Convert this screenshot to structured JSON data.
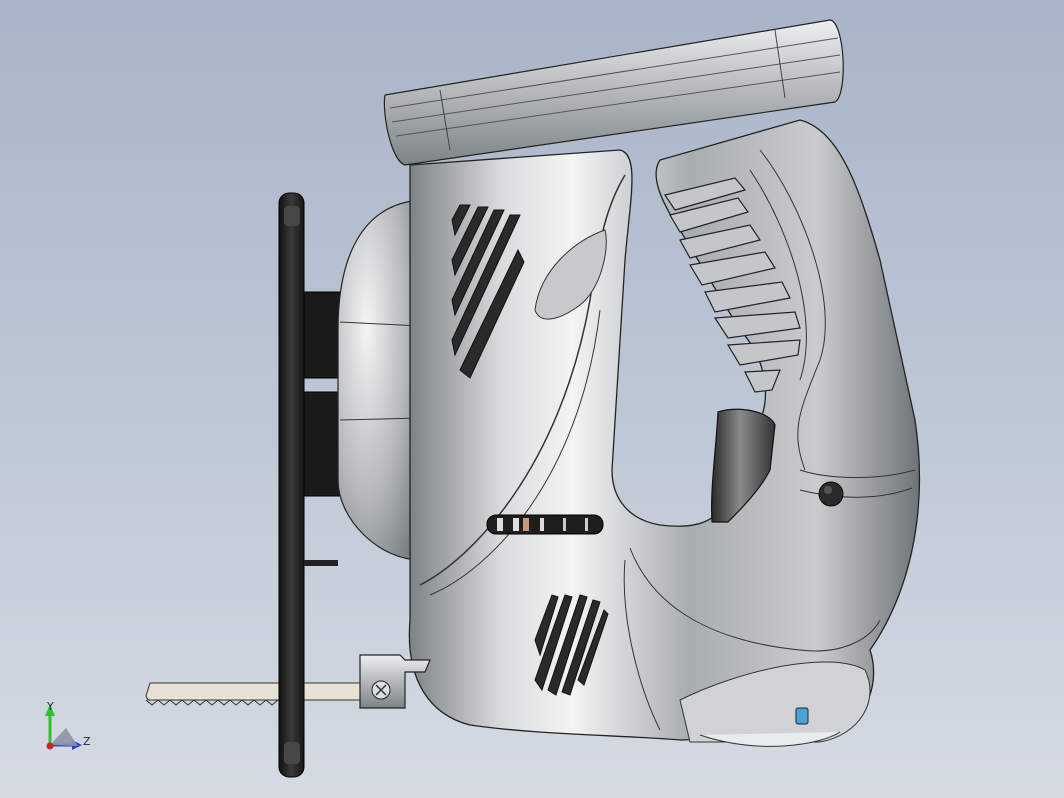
{
  "viewport": {
    "background_top": "#a9b4c8",
    "background_bottom": "#d6dbe3"
  },
  "model": {
    "description_icon": "jigsaw-3d-model",
    "body_color": "#bfc3c6",
    "dark_parts_color": "#232323",
    "blade_color": "#e6e0d2"
  },
  "triad": {
    "y_label": "Y",
    "z_label": "Z",
    "y_color": "#2ec02e",
    "z_color": "#2a3fd8",
    "x_color": "#d0202a"
  }
}
